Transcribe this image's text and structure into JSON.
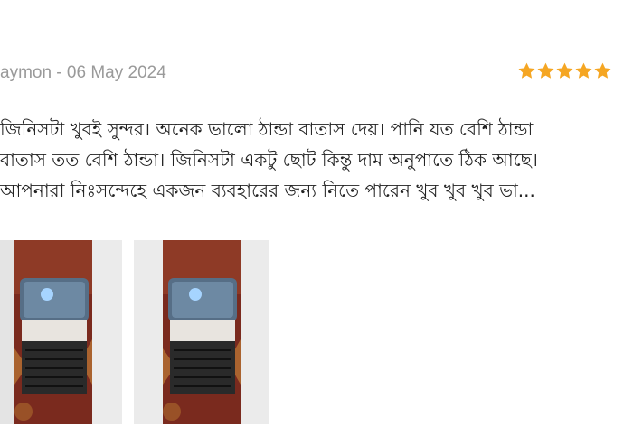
{
  "review": {
    "author_date": "aymon - 06 May 2024",
    "rating": 5,
    "rating_max": 5,
    "star_icon": "star-icon",
    "star_color": "#f5a623",
    "body_lines": [
      "জিনিসটা খুবই সুন্দর। অনেক ভালো ঠান্ডা বাতাস দেয়। পানি যত বেশি ঠান্ডা",
      "বাতাস তত বেশি ঠান্ডা। জিনিসটা একটু ছোট কিন্তু দাম অনুপাতে ঠিক আছে।",
      "আপনারা নিঃসন্দেহে একজন ব্যবহারের জন্য নিতে পারেন খুব খুব খুব ভা..."
    ],
    "photos": [
      {
        "name": "review-photo-1",
        "subject": "mini air cooler"
      },
      {
        "name": "review-photo-2",
        "subject": "mini air cooler"
      }
    ]
  }
}
